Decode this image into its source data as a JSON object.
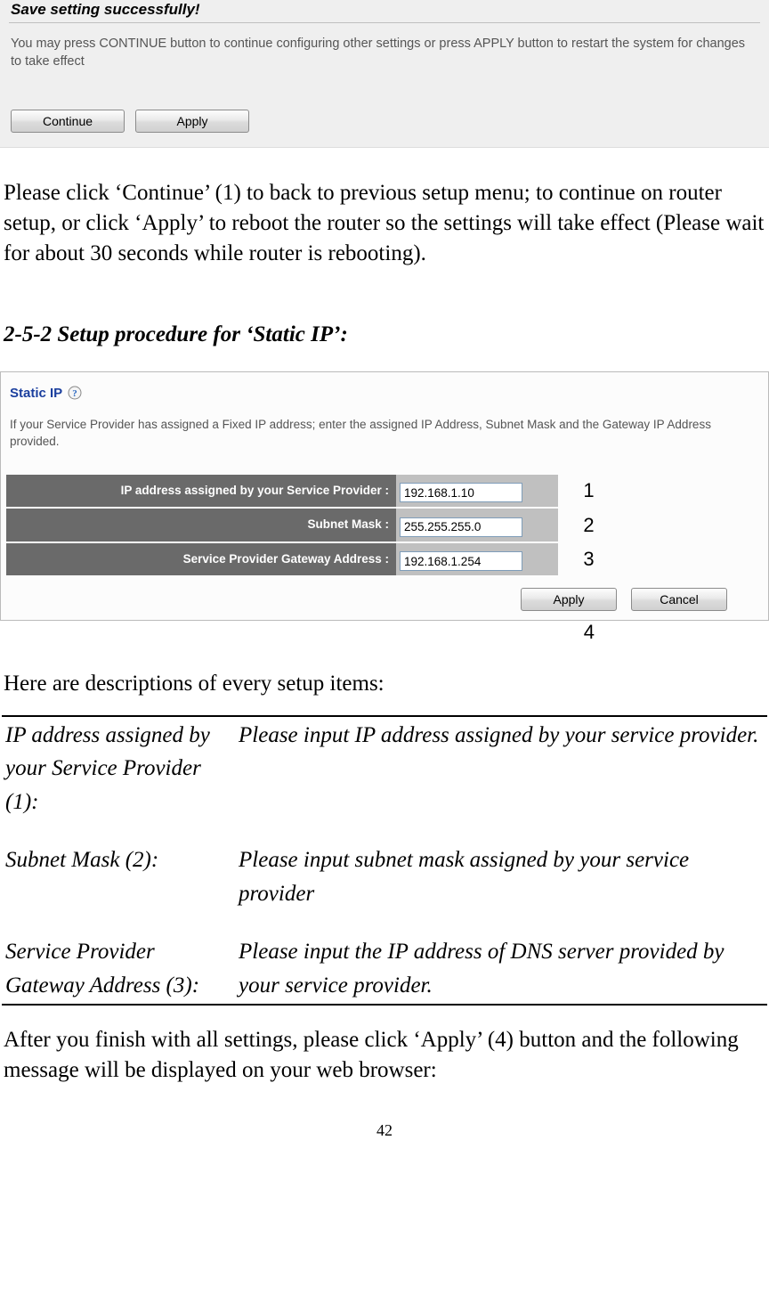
{
  "save_panel": {
    "title": "Save setting successfully!",
    "note": "You may press CONTINUE button to continue configuring other settings or press APPLY button to restart the system for changes to take effect",
    "continue_label": "Continue",
    "apply_label": "Apply"
  },
  "paragraph_continue": "Please click ‘Continue’ (1) to back to previous setup menu; to continue on router setup, or click ‘Apply’ to reboot the router so the settings will take effect (Please wait for about 30 seconds while router is rebooting).",
  "heading_252": "2-5-2 Setup procedure for ‘Static IP’:",
  "static_panel": {
    "title": "Static IP",
    "desc": "If your Service Provider has assigned a Fixed IP address; enter the assigned IP Address, Subnet Mask and the Gateway IP Address provided.",
    "rows": [
      {
        "label": "IP address assigned by your Service Provider :",
        "value": "192.168.1.10",
        "num": "1"
      },
      {
        "label": "Subnet Mask :",
        "value": "255.255.255.0",
        "num": "2"
      },
      {
        "label": "Service Provider Gateway Address :",
        "value": "192.168.1.254",
        "num": "3"
      }
    ],
    "apply_label": "Apply",
    "cancel_label": "Cancel",
    "num4": "4"
  },
  "desc_intro": "Here are descriptions of every setup items:",
  "desc_rows": [
    {
      "label": "IP address assigned by your Service Provider (1):",
      "text": "Please input IP address assigned by your service provider."
    },
    {
      "label": "Subnet Mask (2):",
      "text": "Please input subnet mask assigned by your service provider"
    },
    {
      "label": "Service Provider Gateway Address (3):",
      "text": "Please input the IP address of DNS server provided by your service provider."
    }
  ],
  "after_text": "After you finish with all settings, please click ‘Apply’ (4) button and the following message will be displayed on your web browser:",
  "page_number": "42"
}
